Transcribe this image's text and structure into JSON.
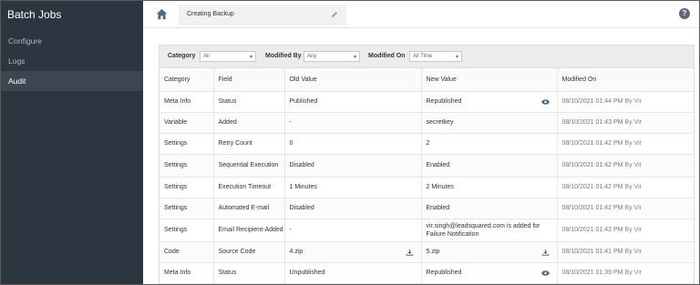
{
  "sidebar": {
    "title": "Batch Jobs",
    "items": [
      {
        "label": "Configure"
      },
      {
        "label": "Logs"
      },
      {
        "label": "Audit"
      }
    ]
  },
  "header": {
    "breadcrumb": "Creating Backup",
    "help": "?"
  },
  "filters": {
    "category_label": "Category",
    "category_value": "All",
    "modified_by_label": "Modified By",
    "modified_by_value": "Any",
    "modified_on_label": "Modified On",
    "modified_on_value": "All Time"
  },
  "table": {
    "headers": [
      "Category",
      "Field",
      "Old Value",
      "New Value",
      "Modified On"
    ],
    "rows": [
      {
        "category": "Meta Info",
        "field": "Status",
        "old": "Published",
        "new": "Republished",
        "date": "08/10/2021 01:44 PM",
        "by": "By Vir"
      },
      {
        "category": "Variable",
        "field": "Added",
        "old": "-",
        "new": "secretkey",
        "date": "08/10/2021 01:43 PM",
        "by": "By Vir"
      },
      {
        "category": "Settings",
        "field": "Retry Count",
        "old": "0",
        "new": "2",
        "date": "08/10/2021 01:42 PM",
        "by": "By Vir"
      },
      {
        "category": "Settings",
        "field": "Sequential Execution",
        "old": "Disabled",
        "new": "Enabled",
        "date": "08/10/2021 01:42 PM",
        "by": "By Vir"
      },
      {
        "category": "Settings",
        "field": "Execution Timeout",
        "old": "1 Minutes",
        "new": "2 Minutes",
        "date": "08/10/2021 01:42 PM",
        "by": "By Vir"
      },
      {
        "category": "Settings",
        "field": "Automated E-mail",
        "old": "Disabled",
        "new": "Enabled",
        "date": "08/10/2021 01:42 PM",
        "by": "By Vir"
      },
      {
        "category": "Settings",
        "field": "Email Recipient-Added",
        "old": "-",
        "new": "vir.singh@leadsquared.com is added for Failure Notification",
        "date": "08/10/2021 01:42 PM",
        "by": "By Vir"
      },
      {
        "category": "Code",
        "field": "Source Code",
        "old": "4.zip",
        "new": "5.zip",
        "date": "08/10/2021 01:41 PM",
        "by": "By Vir"
      },
      {
        "category": "Meta Info",
        "field": "Status",
        "old": "Unpublished",
        "new": "Republished",
        "date": "08/10/2021 01:39 PM",
        "by": "By Vir"
      }
    ]
  },
  "icons": {
    "home": "home-icon",
    "edit": "pencil-icon",
    "view": "eye-icon",
    "download": "download-icon"
  },
  "colors": {
    "sidebar_bg": "#2c3640",
    "accent": "#5b6b7b",
    "icon_blue": "#4b6d8c"
  }
}
